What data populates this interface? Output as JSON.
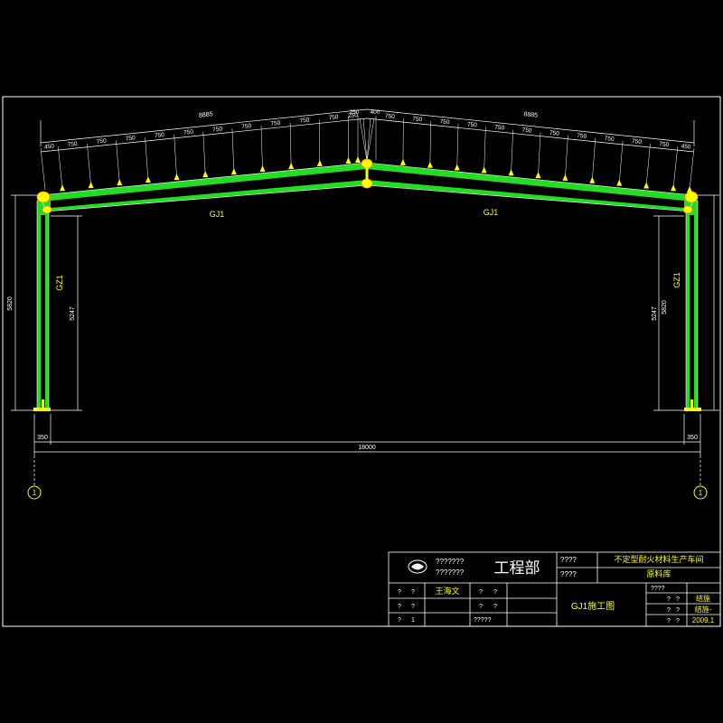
{
  "colors": {
    "background": "#000000",
    "frame": "#ffffff",
    "member": "#22dd22",
    "member_edge": "#ffffff",
    "purlin": "#ffff00",
    "dimension": "#ffffff",
    "title_text": "#ffff00"
  },
  "dimensions": {
    "top_left_total": "8885",
    "top_right_total": "8885",
    "left_spacings": [
      "450",
      "750",
      "750",
      "750",
      "750",
      "750",
      "750",
      "750",
      "750",
      "750",
      "750",
      "250"
    ],
    "center_spacings": [
      "250",
      "400"
    ],
    "right_spacings": [
      "750",
      "750",
      "750",
      "750",
      "750",
      "750",
      "750",
      "750",
      "750",
      "750",
      "750",
      "450"
    ],
    "left_outer_height": "5820",
    "left_inner_height": "5247",
    "right_inner_height": "5247",
    "right_outer_height": "5820",
    "left_base": "350",
    "right_base": "350",
    "span": "18000"
  },
  "labels": {
    "rafter_left": "GJ1",
    "rafter_right": "GJ1",
    "column_left": "GZ1",
    "column_right": "GZ1",
    "axis_left": "1",
    "axis_right": "1"
  },
  "title_block": {
    "company_line1": "???????",
    "company_line2": "???????",
    "department": "工程部",
    "project_label": "????",
    "project_name": "不定型耐火材料生产车间",
    "subproject_label": "????",
    "subproject_name": "原料库",
    "drawing_name": "GJ1施工图",
    "rows": [
      {
        "c1": "?",
        "c2": "?",
        "c3": "王海文",
        "c4": "?",
        "c5": "?"
      },
      {
        "c1": "?",
        "c2": "?",
        "c3": "",
        "c4": "?",
        "c5": "?"
      },
      {
        "c1": "?",
        "c2": "1",
        "c3": "",
        "c4": "?????",
        "c5": ""
      }
    ],
    "right_header": "????",
    "right_rows": [
      {
        "c1": "?",
        "c2": "?",
        "v": "结施"
      },
      {
        "c1": "?",
        "c2": "?",
        "v": "结施-"
      },
      {
        "c1": "?",
        "c2": "?",
        "v": "2009.1"
      }
    ]
  }
}
